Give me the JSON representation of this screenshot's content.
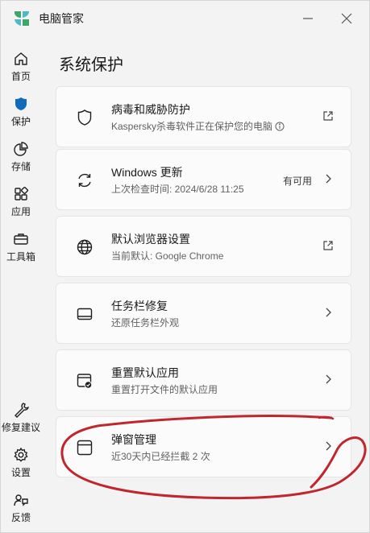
{
  "titlebar": {
    "app_title": "电脑管家"
  },
  "sidebar": {
    "items": [
      {
        "label": "首页",
        "icon": "home-icon"
      },
      {
        "label": "保护",
        "icon": "shield-icon"
      },
      {
        "label": "存储",
        "icon": "pie-chart-icon"
      },
      {
        "label": "应用",
        "icon": "apps-grid-icon"
      },
      {
        "label": "工具箱",
        "icon": "toolbox-icon"
      },
      {
        "label": "修复建议",
        "icon": "wrench-icon"
      },
      {
        "label": "设置",
        "icon": "gear-icon"
      },
      {
        "label": "反馈",
        "icon": "feedback-icon"
      }
    ],
    "active": "保护"
  },
  "main": {
    "title": "系统保护",
    "cards": [
      {
        "title": "病毒和威胁防护",
        "subtitle": "Kaspersky杀毒软件正在保护您的电脑",
        "status": "",
        "icon": "shield-outline-icon",
        "action": "external-link-icon"
      },
      {
        "title": "Windows 更新",
        "subtitle": "上次检查时间: 2024/6/28 11:25",
        "status": "有可用",
        "icon": "refresh-icon",
        "action": "chevron-right-icon"
      },
      {
        "title": "默认浏览器设置",
        "subtitle": "当前默认: Google Chrome",
        "status": "",
        "icon": "globe-icon",
        "action": "external-link-icon"
      },
      {
        "title": "任务栏修复",
        "subtitle": "还原任务栏外观",
        "status": "",
        "icon": "taskbar-icon",
        "action": "chevron-right-icon"
      },
      {
        "title": "重置默认应用",
        "subtitle": "重置打开文件的默认应用",
        "status": "",
        "icon": "reset-apps-icon",
        "action": "chevron-right-icon"
      },
      {
        "title": "弹窗管理",
        "subtitle": "近30天内已经拦截 2 次",
        "status": "",
        "icon": "popup-window-icon",
        "action": "chevron-right-icon"
      }
    ]
  },
  "colors": {
    "accent": "#0f6cbd",
    "annotation": "#c0262d",
    "logo_green": "#3fa66a",
    "logo_teal": "#4fb7c6"
  }
}
